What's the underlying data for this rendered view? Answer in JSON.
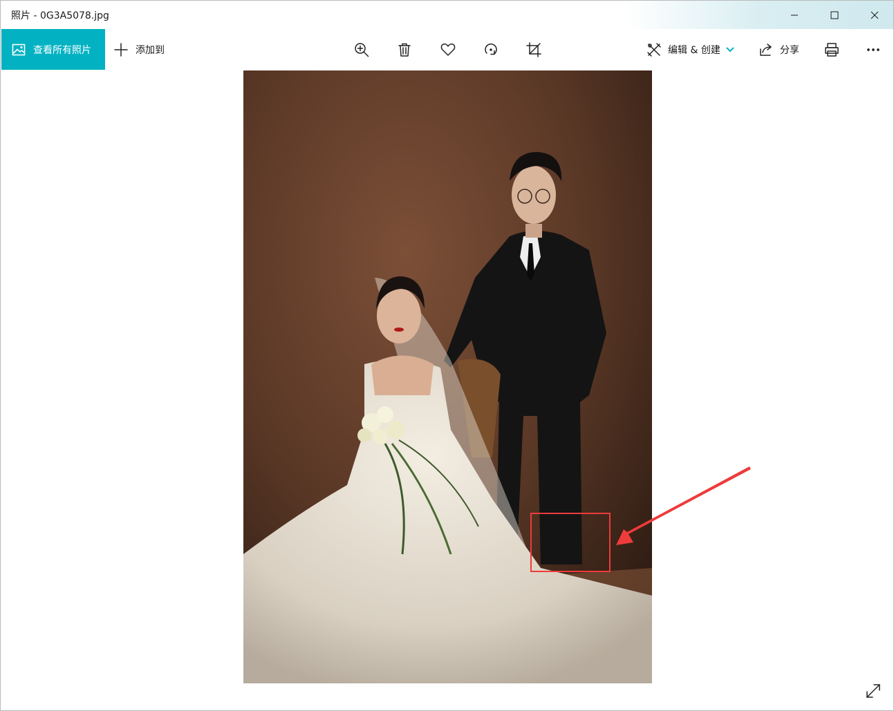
{
  "window": {
    "title": "照片 - 0G3A5078.jpg"
  },
  "toolbar": {
    "view_all_label": "查看所有照片",
    "add_to_label": "添加到",
    "edit_create_label": "编辑 & 创建",
    "share_label": "分享",
    "accent_color": "#03b2c2"
  },
  "icons": {
    "zoom": "zoom-in-icon",
    "delete": "trash-icon",
    "favorite": "heart-icon",
    "rotate": "rotate-icon",
    "crop": "crop-icon",
    "print": "print-icon",
    "more": "more-icon",
    "expand": "expand-icon"
  },
  "annotation": {
    "color": "#ee3b3b"
  }
}
